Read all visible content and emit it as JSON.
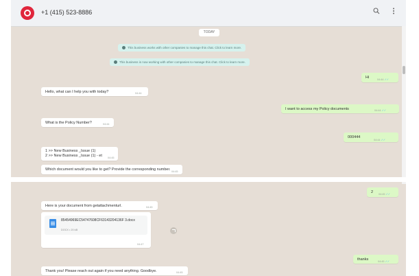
{
  "header": {
    "phone": "+1 (415) 523-8886",
    "search_icon": "search-icon",
    "menu_icon": "kebab-menu-icon",
    "logo_icon": "twilio-logo-icon"
  },
  "date_label": "TODAY",
  "notices": [
    "This business works with other companies to manage this chat. Click to learn more.",
    "This business is now working with other companies to manage this chat. Click to learn more."
  ],
  "messages": [
    {
      "id": "m1",
      "dir": "out",
      "text": "Hi",
      "time": "04:44"
    },
    {
      "id": "m2",
      "dir": "in",
      "text": "Hello, what can I help you with today?",
      "time": "04:44"
    },
    {
      "id": "m3",
      "dir": "out",
      "text": "I want to access my Policy documents",
      "time": "04:44"
    },
    {
      "id": "m4",
      "dir": "in",
      "text": "What is the Policy Number?",
      "time": "04:44"
    },
    {
      "id": "m5",
      "dir": "out",
      "text": "000444",
      "time": "04:44"
    },
    {
      "id": "m6",
      "dir": "in",
      "lines": [
        "1 >> New Business _Issue (1)",
        "2 >> New Business _Issue (1) - et"
      ],
      "time": "04:45"
    },
    {
      "id": "m7",
      "dir": "in",
      "text": "Which document would you like to get? Provide the corresponding number.",
      "time": "04:45"
    },
    {
      "id": "m8",
      "dir": "out",
      "text": "2",
      "time": "04:45"
    },
    {
      "id": "m9",
      "dir": "in",
      "text": "Here is your document from getattachmenturl.",
      "time": "04:45"
    },
    {
      "id": "m10",
      "dir": "in",
      "doc": {
        "name": "85454969EC54747608CF63143204136F 3.docx",
        "size": "DOCX • 20 kB"
      },
      "time": "04:47"
    },
    {
      "id": "m11",
      "dir": "out",
      "text": "thanks",
      "time": "04:45"
    },
    {
      "id": "m12",
      "dir": "in",
      "text": "Thank you! Please reach out again if you need anything. Goodbye.",
      "time": "04:45"
    }
  ],
  "colors": {
    "chat_bg": "#e6ded6",
    "outgoing": "#dcf8c6",
    "incoming": "#ffffff",
    "notice": "#d6f2ee",
    "brand": "#e0263c"
  }
}
